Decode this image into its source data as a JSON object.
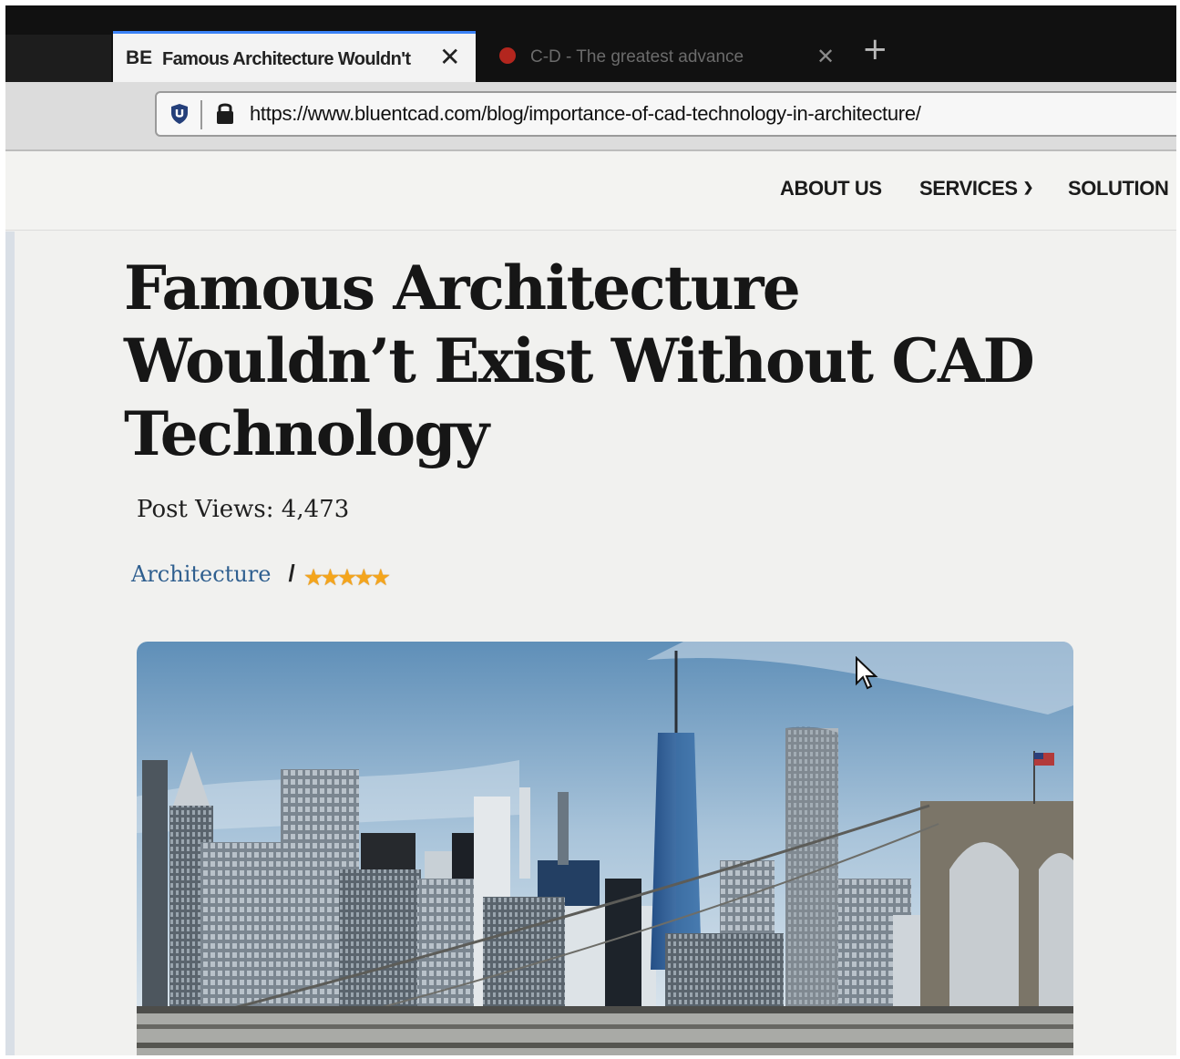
{
  "browser": {
    "active_tab": {
      "favicon_text": "BE",
      "title": "Famous Architecture Wouldn't"
    },
    "second_tab": {
      "title": "C-D - The greatest advance"
    },
    "url": "https://www.bluentcad.com/blog/importance-of-cad-technology-in-architecture/",
    "icons": [
      "shield-icon",
      "lock-icon",
      "close-icon",
      "plus-icon"
    ]
  },
  "nav": {
    "about": "ABOUT US",
    "services": "SERVICES",
    "solutions": "SOLUTION"
  },
  "article": {
    "title": "Famous Architecture Wouldn’t Exist Without CAD Technology",
    "views_label": "Post Views:",
    "views_count": "4,473",
    "category": "Architecture",
    "separator": "/",
    "rating_stars": 5
  },
  "colors": {
    "accent_tab": "#3b82f6",
    "category_link": "#2f5f8f",
    "star": "#f4a51c"
  }
}
